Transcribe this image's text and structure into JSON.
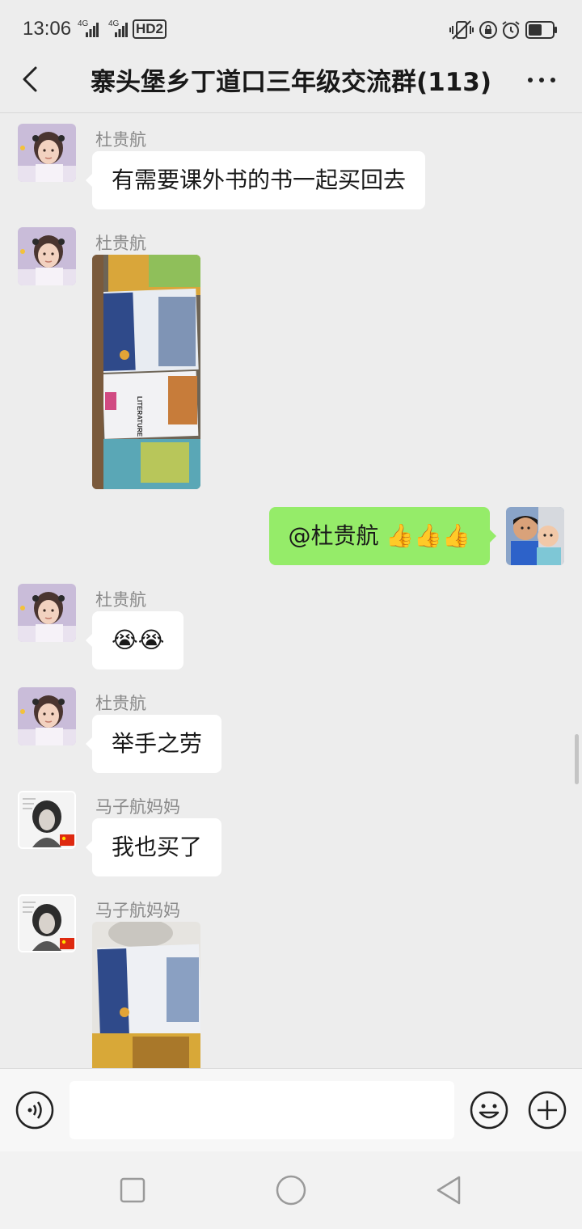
{
  "status": {
    "time": "13:06",
    "signal_1": "4G",
    "signal_2": "4G",
    "hd_label": "HD2"
  },
  "nav": {
    "title": "寨头堡乡丁道口三年级交流群(113)"
  },
  "messages": [
    {
      "sender": "杜贵航",
      "text": "有需要课外书的书一起买回去"
    },
    {
      "sender": "杜贵航"
    },
    {
      "text": "@杜贵航 👍👍👍"
    },
    {
      "sender": "杜贵航",
      "text": "😭😭"
    },
    {
      "sender": "杜贵航",
      "text": "举手之劳"
    },
    {
      "sender": "马子航妈妈",
      "text": "我也买了"
    },
    {
      "sender": "马子航妈妈"
    }
  ],
  "photo_text": {
    "book_spine": "LITERATURE OF CLASSIC"
  },
  "input": {
    "placeholder": ""
  },
  "colors": {
    "background": "#ededed",
    "bubble_self": "#95ec69",
    "bubble_other": "#ffffff"
  }
}
